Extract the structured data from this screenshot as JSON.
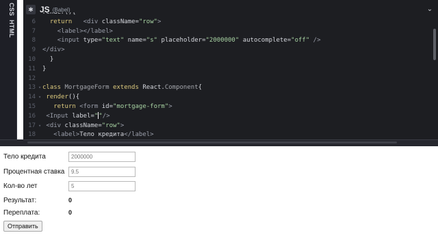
{
  "side_tabs": [
    "CSS",
    "HTML"
  ],
  "editor": {
    "language": "JS",
    "preprocessor": "(Babel)",
    "gear_icon": "gear-icon",
    "collapse_icon": "chevron-down-icon"
  },
  "code_lines": [
    {
      "n": "",
      "fold": "",
      "html": "<span class='plain'>render(){</span>"
    },
    {
      "n": "6",
      "fold": "",
      "html": "  <span class='kw'>return</span>   <span class='tag'>&lt;div</span> <span class='attr'>className</span><span class='punc'>=</span><span class='str'>\"row\"</span><span class='tag'>&gt;</span>"
    },
    {
      "n": "7",
      "fold": "",
      "html": "    <span class='tag'>&lt;label&gt;&lt;/label&gt;</span>"
    },
    {
      "n": "8",
      "fold": "",
      "html": "    <span class='tag'>&lt;input</span> <span class='attr'>type</span><span class='punc'>=</span><span class='str'>\"text\"</span> <span class='attr'>name</span><span class='punc'>=</span><span class='str'>\"s\"</span> <span class='attr'>placeholder</span><span class='punc'>=</span><span class='str'>\"2000000\"</span> <span class='attr'>autocomplete</span><span class='punc'>=</span><span class='str'>\"off\"</span> <span class='tag'>/&gt;</span>"
    },
    {
      "n": "9",
      "fold": "",
      "html": "<span class='tag'>&lt;/div&gt;</span>"
    },
    {
      "n": "10",
      "fold": "",
      "html": "  <span class='punc'>}</span>"
    },
    {
      "n": "11",
      "fold": "",
      "html": "<span class='punc'>}</span>"
    },
    {
      "n": "12",
      "fold": "",
      "html": ""
    },
    {
      "n": "13",
      "fold": "▾",
      "html": "<span class='kw'>class</span> <span class='cls'>MortgageForm</span> <span class='kw'>extends</span> <span class='plain'>React</span><span class='punc'>.</span><span class='cls'>Component</span><span class='punc'>{</span>"
    },
    {
      "n": "14",
      "fold": "▾",
      "html": " <span class='fn'>render</span><span class='punc'>(){</span>"
    },
    {
      "n": "15",
      "fold": "",
      "html": "   <span class='kw'>return</span> <span class='tag'>&lt;form</span> <span class='attr'>id</span><span class='punc'>=</span><span class='str'>\"mortgage-form\"</span><span class='tag'>&gt;</span>"
    },
    {
      "n": "16",
      "fold": "",
      "html": " <span class='tag'>&lt;Input</span> <span class='attr'>label</span><span class='punc'>=</span><span class='str'>\"</span><span class='cursor'></span><span class='str'>\"</span><span class='tag'>/&gt;</span>"
    },
    {
      "n": "17",
      "fold": "▾",
      "html": " <span class='tag'>&lt;div</span> <span class='attr'>className</span><span class='punc'>=</span><span class='str'>\"row\"</span><span class='tag'>&gt;</span>"
    },
    {
      "n": "18",
      "fold": "",
      "html": "   <span class='tag'>&lt;label&gt;</span><span class='plain'>Тело кредита</span><span class='tag'>&lt;/label&gt;</span>"
    }
  ],
  "form": {
    "fields": [
      {
        "label": "Тело кредита",
        "placeholder": "2000000"
      },
      {
        "label": "Процентная ставка",
        "placeholder": "9.5"
      },
      {
        "label": "Кол-во лет",
        "placeholder": "5"
      }
    ],
    "results": [
      {
        "label": "Результат:",
        "value": "0"
      },
      {
        "label": "Переплата:",
        "value": "0"
      }
    ],
    "submit_label": "Отправить"
  }
}
